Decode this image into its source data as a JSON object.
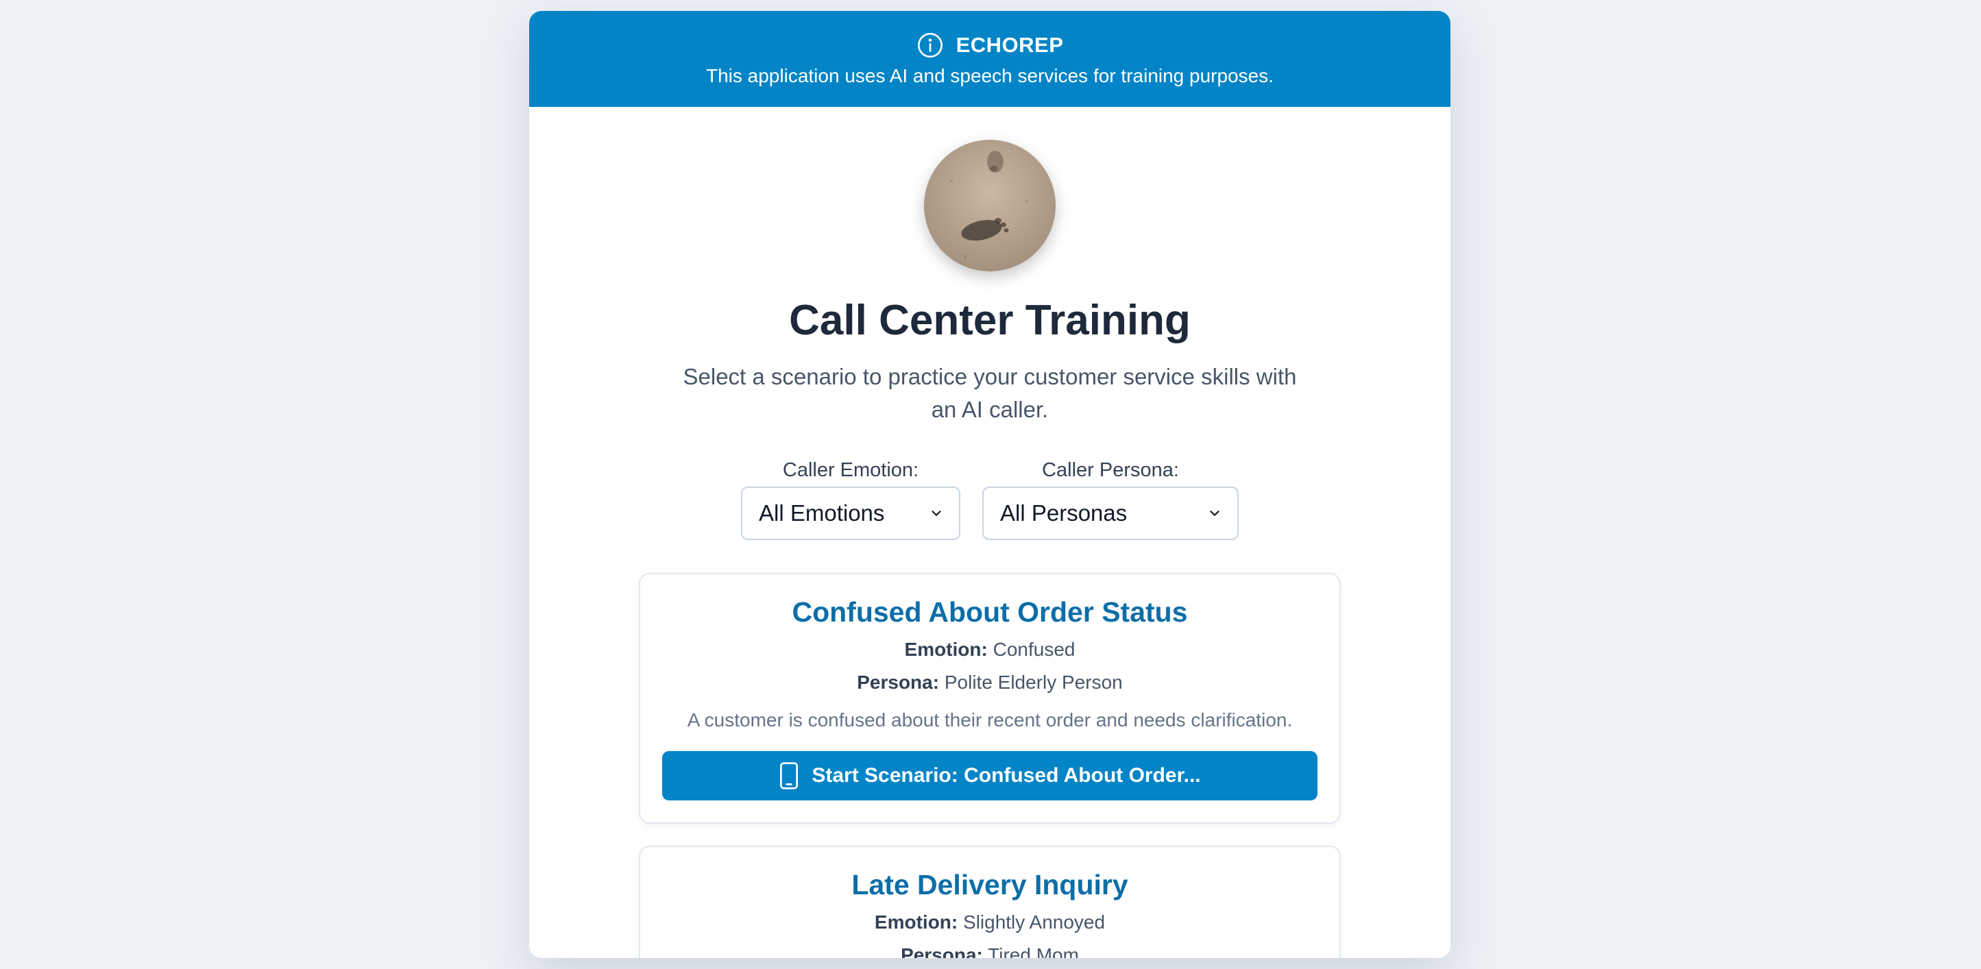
{
  "banner": {
    "brand": "ECHOREP",
    "notice": "This application uses AI and speech services for training purposes."
  },
  "page": {
    "title": "Call Center Training",
    "subtitle": "Select a scenario to practice your customer service skills with an AI caller."
  },
  "filters": {
    "emotion_label": "Caller Emotion:",
    "emotion_value": "All Emotions",
    "persona_label": "Caller Persona:",
    "persona_value": "All Personas"
  },
  "scenarios": [
    {
      "title": "Confused About Order Status",
      "emotion_label": "Emotion:",
      "emotion": "Confused",
      "persona_label": "Persona:",
      "persona": "Polite Elderly Person",
      "description": "A customer is confused about their recent order and needs clarification.",
      "button": "Start Scenario: Confused About Order..."
    },
    {
      "title": "Late Delivery Inquiry",
      "emotion_label": "Emotion:",
      "emotion": "Slightly Annoyed",
      "persona_label": "Persona:",
      "persona": "Tired Mom"
    }
  ],
  "colors": {
    "accent": "#0284c7",
    "card_title": "#0b6ea8",
    "background": "#eef2f7"
  },
  "icons": {
    "banner": "info-icon",
    "button": "phone-icon",
    "select": "chevron-down-icon"
  }
}
